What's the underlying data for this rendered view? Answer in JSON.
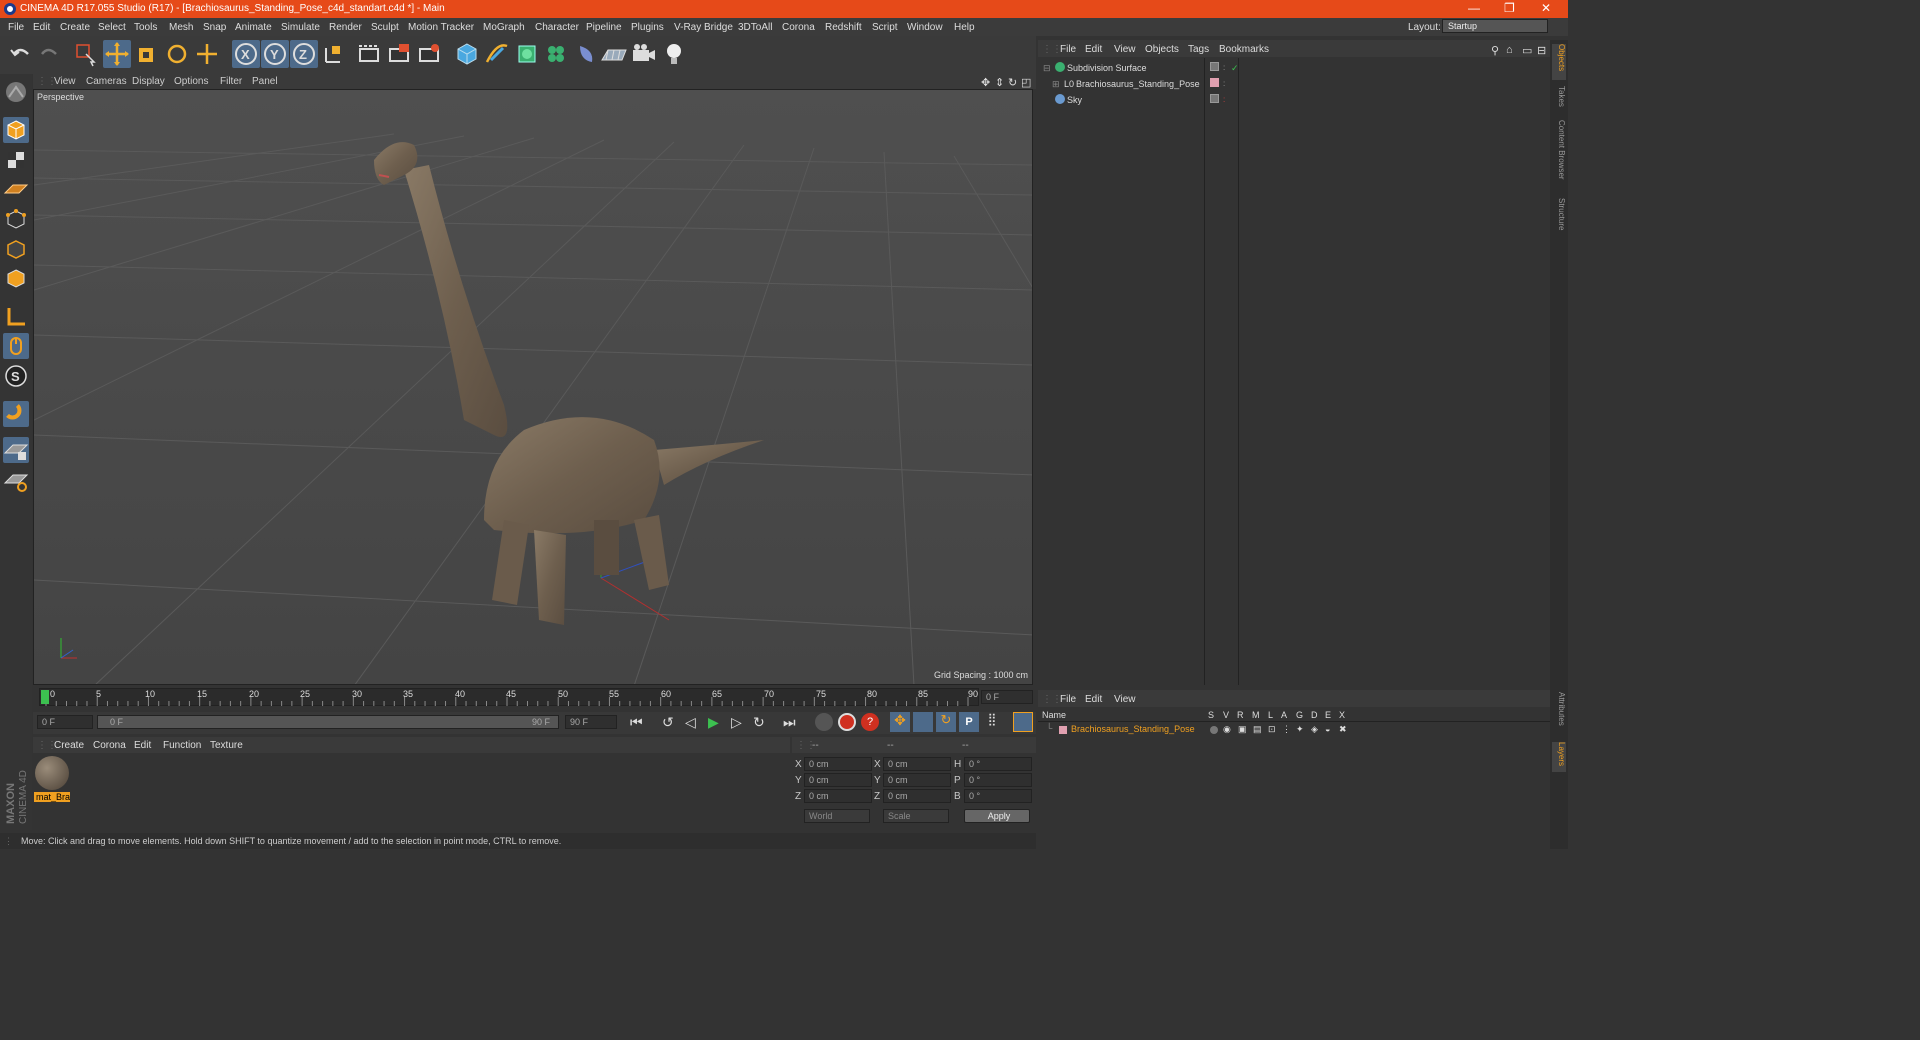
{
  "window": {
    "title": "CINEMA 4D R17.055 Studio (R17) - [Brachiosaurus_Standing_Pose_c4d_standart.c4d *] - Main",
    "minimize": "—",
    "restore": "❐",
    "close": "✕"
  },
  "menu": [
    "File",
    "Edit",
    "Create",
    "Select",
    "Tools",
    "Mesh",
    "Snap",
    "Animate",
    "Simulate",
    "Render",
    "Sculpt",
    "Motion Tracker",
    "MoGraph",
    "Character",
    "Pipeline",
    "Plugins",
    "V-Ray Bridge",
    "3DToAll",
    "Corona",
    "Redshift",
    "Script",
    "Window",
    "Help"
  ],
  "layout": {
    "label": "Layout:",
    "value": "Startup"
  },
  "viewport": {
    "menu": [
      "View",
      "Cameras",
      "Display",
      "Options",
      "Filter",
      "Panel"
    ],
    "label": "Perspective",
    "grid_spacing": "Grid Spacing : 1000 cm"
  },
  "timeline": {
    "ticks": [
      "0",
      "5",
      "10",
      "15",
      "20",
      "25",
      "30",
      "35",
      "40",
      "45",
      "50",
      "55",
      "60",
      "65",
      "70",
      "75",
      "80",
      "85",
      "90"
    ],
    "current_frame": "0 F",
    "start_field": "0 F",
    "range_start": "0 F",
    "range_end": "90 F",
    "end_field": "90 F"
  },
  "material_panel": {
    "menu": [
      "Create",
      "Corona",
      "Edit",
      "Function",
      "Texture"
    ],
    "materials": [
      {
        "name": "mat_Bra"
      }
    ]
  },
  "coords": {
    "headers": [
      "--",
      "--",
      "--"
    ],
    "rows": [
      {
        "a": "X",
        "v1": "0 cm",
        "b": "X",
        "v2": "0 cm",
        "c": "H",
        "v3": "0 °"
      },
      {
        "a": "Y",
        "v1": "0 cm",
        "b": "Y",
        "v2": "0 cm",
        "c": "P",
        "v3": "0 °"
      },
      {
        "a": "Z",
        "v1": "0 cm",
        "b": "Z",
        "v2": "0 cm",
        "c": "B",
        "v3": "0 °"
      }
    ],
    "space": "World",
    "mode": "Scale",
    "apply": "Apply"
  },
  "status": "Move: Click and drag to move elements. Hold down SHIFT to quantize movement / add to the selection in point mode, CTRL to remove.",
  "object_manager": {
    "menu": [
      "File",
      "Edit",
      "View",
      "Objects",
      "Tags",
      "Bookmarks"
    ],
    "objects": [
      "Subdivision Surface",
      "Brachiosaurus_Standing_Pose",
      "Sky"
    ]
  },
  "layer_manager": {
    "menu": [
      "File",
      "Edit",
      "View"
    ],
    "columns": [
      "Name",
      "S",
      "V",
      "R",
      "M",
      "L",
      "A",
      "G",
      "D",
      "E",
      "X"
    ],
    "layers": [
      "Brachiosaurus_Standing_Pose"
    ]
  },
  "right_tabs": [
    "Objects",
    "Takes",
    "Content Browser",
    "Structure",
    "Attributes",
    "Layers"
  ],
  "brand": [
    "MAXON",
    "CINEMA 4D"
  ],
  "colors": {
    "title_bar": "#e64a19",
    "accent": "#f0a020",
    "selected_tool": "#4d6a8a"
  }
}
